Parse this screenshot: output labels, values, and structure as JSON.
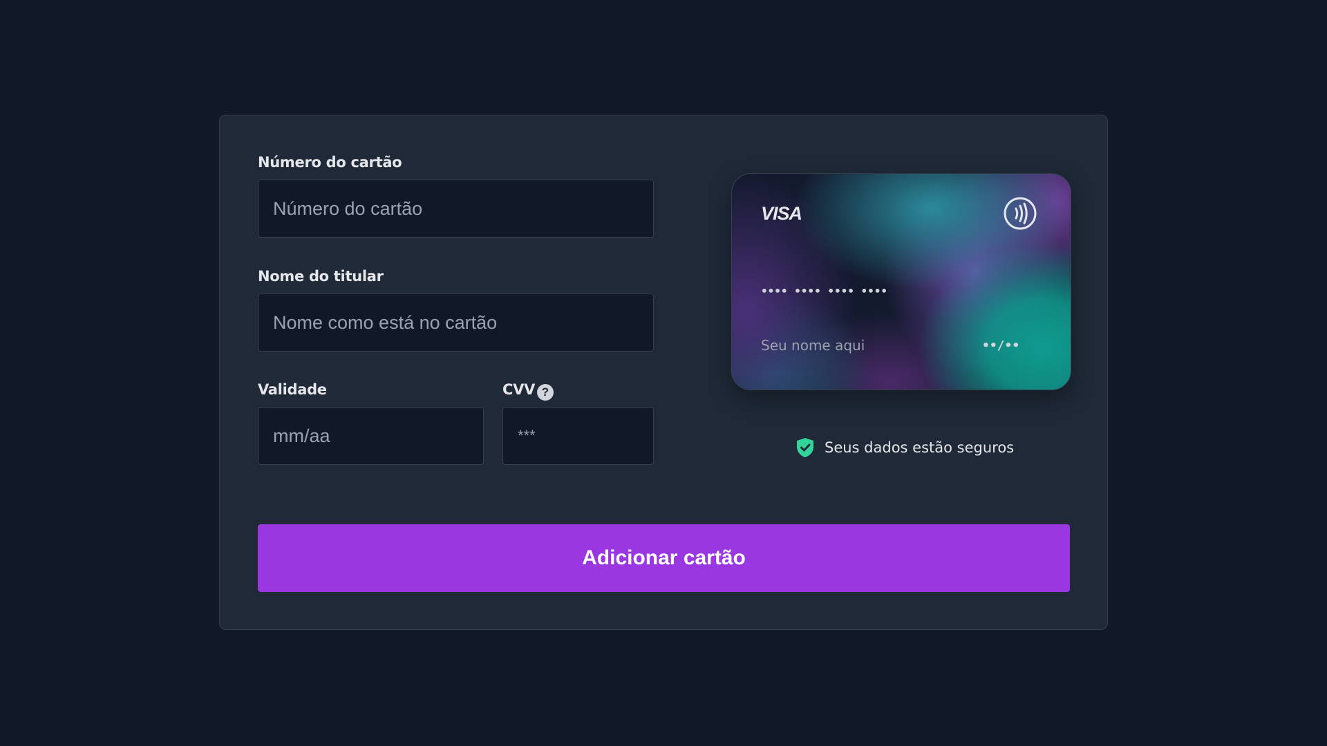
{
  "form": {
    "card_number": {
      "label": "Número do cartão",
      "placeholder": "Número do cartão",
      "value": ""
    },
    "holder_name": {
      "label": "Nome do titular",
      "placeholder": "Nome como está no cartão",
      "value": ""
    },
    "expiry": {
      "label": "Validade",
      "placeholder": "mm/aa",
      "value": ""
    },
    "cvv": {
      "label": "CVV",
      "help_glyph": "?",
      "placeholder": "***",
      "value": ""
    },
    "submit_label": "Adicionar cartão"
  },
  "card_preview": {
    "brand": "VISA",
    "number_mask": "•••• •••• •••• ••••",
    "name_placeholder": "Seu nome aqui",
    "expiry_mask": "••/••",
    "icons": [
      "contactless-icon"
    ]
  },
  "security_note": {
    "text": "Seus dados estão seguros",
    "icon": "shield-check-icon"
  },
  "colors": {
    "background": "#111827",
    "panel": "#1f2937",
    "accent": "#9b37e0",
    "secure_green": "#34d399"
  }
}
